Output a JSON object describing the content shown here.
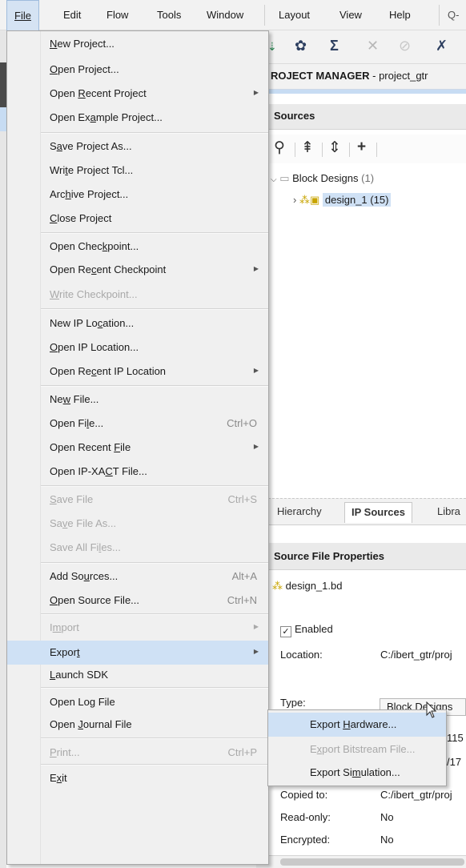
{
  "menubar": {
    "items": [
      "File",
      "Edit",
      "Flow",
      "Tools",
      "Window",
      "Layout",
      "View",
      "Help"
    ],
    "search_glyph": "Q-"
  },
  "toolbar": {
    "icons": [
      "step-icon",
      "gear-icon",
      "sigma-icon",
      "ruler-icon",
      "wand-icon",
      "cross-tool-icon"
    ]
  },
  "project_manager": {
    "title_bold": "ROJECT MANAGER",
    "title_rest": " - project_gtr"
  },
  "sources": {
    "title": "Sources",
    "tree": {
      "root_label": "Block Designs",
      "root_count": "(1)",
      "child_label": "design_1",
      "child_count": "(15)"
    },
    "tabs": [
      "Hierarchy",
      "IP Sources",
      "Libra"
    ]
  },
  "properties": {
    "title": "Source File Properties",
    "file": "design_1.bd",
    "enabled_label": "Enabled",
    "rows": [
      {
        "label": "Location:",
        "value": "C:/ibert_gtr/proj"
      },
      {
        "label": "Type:",
        "value": "Block Designs"
      },
      {
        "label": "",
        "value": "115"
      },
      {
        "label": "",
        "value": "/17"
      },
      {
        "label": "Copied to:",
        "value": "C:/ibert_gtr/proj"
      },
      {
        "label": "Read-only:",
        "value": "No"
      },
      {
        "label": "Encrypted:",
        "value": "No"
      }
    ]
  },
  "file_menu": {
    "items": [
      {
        "label": "New Project...",
        "u": 0
      },
      {
        "label": "Open Project...",
        "u": 0
      },
      {
        "label": "Open Recent Project",
        "u": 5,
        "submenu": true
      },
      {
        "label": "Open Example Project...",
        "u": 7
      },
      {
        "label": "Save Project As...",
        "u": 1
      },
      {
        "label": "Write Project Tcl...",
        "u": 3
      },
      {
        "label": "Archive Project...",
        "u": 3
      },
      {
        "label": "Close Project",
        "u": 0
      },
      {
        "label": "Open Checkpoint...",
        "u": 9
      },
      {
        "label": "Open Recent Checkpoint",
        "u": 7,
        "submenu": true
      },
      {
        "label": "Write Checkpoint...",
        "u": 0,
        "disabled": true
      },
      {
        "label": "New IP Location...",
        "u": 9
      },
      {
        "label": "Open IP Location...",
        "u": 0
      },
      {
        "label": "Open Recent IP Location",
        "u": 7,
        "submenu": true
      },
      {
        "label": "New File...",
        "u": 2
      },
      {
        "label": "Open File...",
        "u": 7,
        "shortcut": "Ctrl+O"
      },
      {
        "label": "Open Recent File",
        "u": 12,
        "submenu": true
      },
      {
        "label": "Open IP-XACT File...",
        "u": 10
      },
      {
        "label": "Save File",
        "u": 0,
        "shortcut": "Ctrl+S",
        "disabled": true
      },
      {
        "label": "Save File As...",
        "u": 2,
        "disabled": true
      },
      {
        "label": "Save All Files...",
        "u": 11,
        "disabled": true
      },
      {
        "label": "Add Sources...",
        "u": 6,
        "shortcut": "Alt+A"
      },
      {
        "label": "Open Source File...",
        "u": 0,
        "shortcut": "Ctrl+N"
      },
      {
        "label": "Import",
        "u": 1,
        "submenu": true,
        "disabled": true
      },
      {
        "label": "Export",
        "u": 5,
        "submenu": true,
        "highlighted": true
      },
      {
        "label": "Launch SDK",
        "u": 0
      },
      {
        "label": "Open Log File",
        "u": 7
      },
      {
        "label": "Open Journal File",
        "u": 5
      },
      {
        "label": "Print...",
        "u": 0,
        "shortcut": "Ctrl+P",
        "disabled": true
      },
      {
        "label": "Exit",
        "u": 1
      }
    ]
  },
  "export_submenu": {
    "items": [
      {
        "label": "Export Hardware...",
        "u": 7,
        "highlighted": true
      },
      {
        "label": "Export Bitstream File...",
        "u": 1,
        "disabled": true
      },
      {
        "label": "Export Simulation...",
        "u": 9
      }
    ]
  }
}
